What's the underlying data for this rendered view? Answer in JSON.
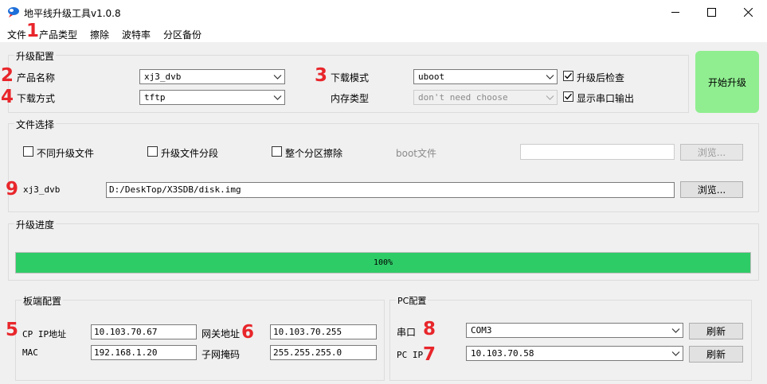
{
  "window": {
    "title": "地平线升级工具v1.0.8"
  },
  "menu": {
    "items": [
      "文件",
      "产品类型",
      "擦除",
      "波特率",
      "分区备份"
    ]
  },
  "annotations": [
    "1",
    "2",
    "3",
    "4",
    "5",
    "6",
    "7",
    "8",
    "9"
  ],
  "upgrade_config": {
    "title": "升级配置",
    "product_name_label": "产品名称",
    "product_name_value": "xj3_dvb",
    "download_method_label": "下载方式",
    "download_method_value": "tftp",
    "download_mode_label": "下载模式",
    "download_mode_value": "uboot",
    "memory_type_label": "内存类型",
    "memory_type_value": "don't need choose",
    "check_after_upgrade_label": "升级后检查",
    "check_after_upgrade_checked": true,
    "show_serial_output_label": "显示串口输出",
    "show_serial_output_checked": true
  },
  "start_button": {
    "label": "开始升级",
    "color": "#90ee90"
  },
  "file_select": {
    "title": "文件选择",
    "different_upgrade_files_label": "不同升级文件",
    "segmented_upgrade_label": "升级文件分段",
    "full_partition_erase_label": "整个分区擦除",
    "boot_file_label": "boot文件",
    "boot_file_value": "",
    "boot_browse_label": "浏览...",
    "image_label": "xj3_dvb",
    "image_path": "D:/DeskTop/X3SDB/disk.img",
    "image_browse_label": "浏览..."
  },
  "progress": {
    "title": "升级进度",
    "text": "100%",
    "fraction": 1.0,
    "color": "#2ecc67"
  },
  "board_config": {
    "title": "板端配置",
    "cp_ip_label": "CP IP地址",
    "cp_ip_value": "10.103.70.67",
    "mac_label": "MAC",
    "mac_value": "192.168.1.20",
    "gateway_label": "网关地址",
    "gateway_value": "10.103.70.255",
    "netmask_label": "子网掩码",
    "netmask_value": "255.255.255.0"
  },
  "pc_config": {
    "title": "PC配置",
    "serial_label": "串口",
    "serial_value": "COM3",
    "serial_refresh_label": "刷新",
    "pc_ip_label": "PC IP",
    "pc_ip_value": "10.103.70.58",
    "pc_ip_refresh_label": "刷新"
  },
  "colors": {
    "annotation": "#e8262b",
    "window_bg": "#f0f0f0"
  }
}
